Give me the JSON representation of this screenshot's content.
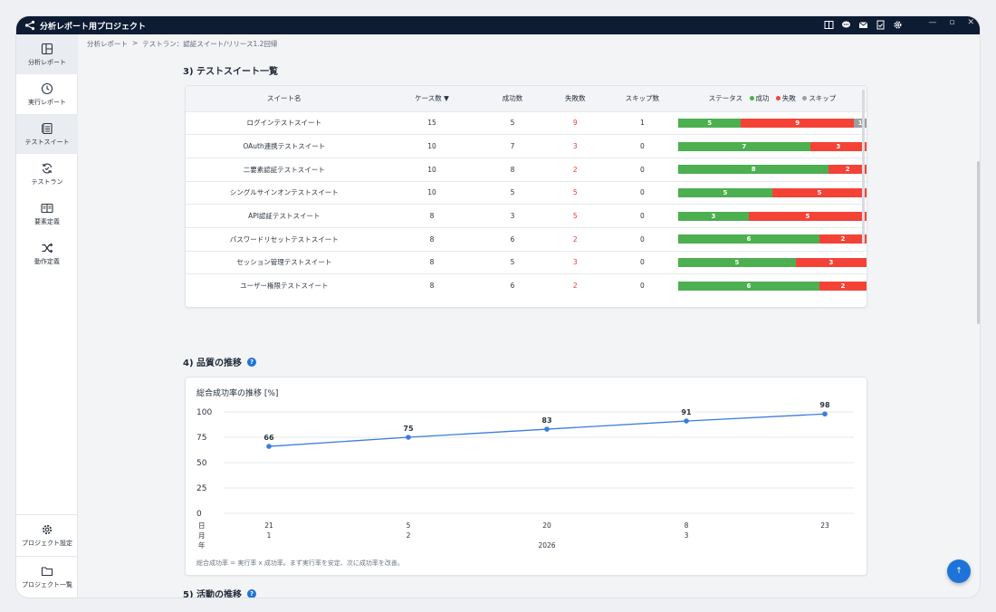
{
  "app": {
    "title": "分析レポート用プロジェクト"
  },
  "titlebar_icons": [
    "book-icon",
    "chat-icon",
    "mail-icon",
    "document-icon",
    "gear-icon"
  ],
  "window_controls": {
    "minimize": "—",
    "restore": "▫",
    "close": "✕"
  },
  "sidebar": {
    "items": [
      {
        "label": "分析レポート",
        "icon": "layout-icon",
        "active": true
      },
      {
        "label": "実行レポート",
        "icon": "clock-icon",
        "active": false
      },
      {
        "label": "テストスイート",
        "icon": "list-icon",
        "active": true
      },
      {
        "label": "テストラン",
        "icon": "sync-icon",
        "active": false
      },
      {
        "label": "要素定義",
        "icon": "book-open-icon",
        "active": false
      },
      {
        "label": "動作定義",
        "icon": "shuffle-icon",
        "active": false
      }
    ],
    "bottom": [
      {
        "label": "プロジェクト設定",
        "icon": "gear-icon"
      },
      {
        "label": "プロジェクト一覧",
        "icon": "folder-icon"
      }
    ]
  },
  "breadcrumb": {
    "root": "分析レポート",
    "sep": ">",
    "current": "テストラン：認証スイート/リリース1.2回帰"
  },
  "suites": {
    "title": "3) テストスイート一覧",
    "headers": {
      "name": "スイート名",
      "cases": "ケース数 ▼",
      "success": "成功数",
      "fail": "失敗数",
      "skip": "スキップ数",
      "status": "ステータス"
    },
    "legend": {
      "success": "成功",
      "fail": "失敗",
      "skip": "スキップ"
    },
    "colors": {
      "success": "#4caf50",
      "fail": "#f44336",
      "skip": "#9e9e9e"
    },
    "rows": [
      {
        "name": "ログインテストスイート",
        "cases": 15,
        "success": 5,
        "fail": 9,
        "skip": 1
      },
      {
        "name": "OAuth連携テストスイート",
        "cases": 10,
        "success": 7,
        "fail": 3,
        "skip": 0
      },
      {
        "name": "二要素認証テストスイート",
        "cases": 10,
        "success": 8,
        "fail": 2,
        "skip": 0
      },
      {
        "name": "シングルサインオンテストスイート",
        "cases": 10,
        "success": 5,
        "fail": 5,
        "skip": 0
      },
      {
        "name": "API認証テストスイート",
        "cases": 8,
        "success": 3,
        "fail": 5,
        "skip": 0
      },
      {
        "name": "パスワードリセットテストスイート",
        "cases": 8,
        "success": 6,
        "fail": 2,
        "skip": 0
      },
      {
        "name": "セッション管理テストスイート",
        "cases": 8,
        "success": 5,
        "fail": 3,
        "skip": 0
      },
      {
        "name": "ユーザー権限テストスイート",
        "cases": 8,
        "success": 6,
        "fail": 2,
        "skip": 0
      }
    ]
  },
  "quality": {
    "title": "4) 品質の推移",
    "chart_title": "総合成功率の推移 [%]",
    "note": "総合成功率 = 実行率 x 成功率。まず実行率を安定、次に成功率を改善。"
  },
  "activity": {
    "title": "5) 活動の推移"
  },
  "fab": {
    "label": "↑"
  },
  "chart_data": {
    "type": "line",
    "title": "総合成功率の推移 [%]",
    "ylabel": "",
    "ylim": [
      0,
      100
    ],
    "yticks": [
      0,
      25,
      50,
      75,
      100
    ],
    "x_axis_label_lines": [
      "日",
      "月",
      "年"
    ],
    "categories": [
      {
        "day": "21",
        "month": "1"
      },
      {
        "day": "5",
        "month": "2"
      },
      {
        "day": "20",
        "month": ""
      },
      {
        "day": "8",
        "month": "3"
      },
      {
        "day": "23",
        "month": ""
      }
    ],
    "year_label": "2026",
    "series": [
      {
        "values": [
          66,
          75,
          83,
          91,
          98
        ],
        "color": "#3b7ddd"
      }
    ],
    "grid": true
  }
}
